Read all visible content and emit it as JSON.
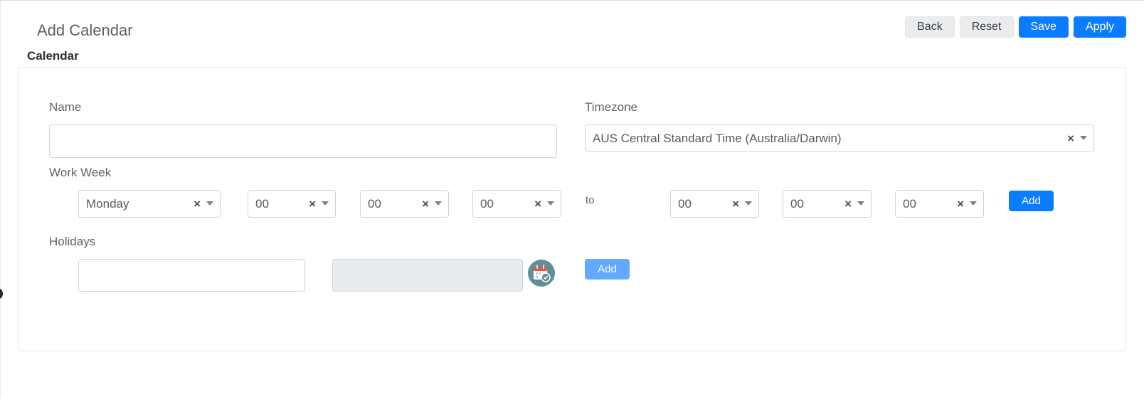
{
  "header": {
    "title": "Add Calendar",
    "section": "Calendar"
  },
  "toolbar": {
    "back_label": "Back",
    "reset_label": "Reset",
    "save_label": "Save",
    "apply_label": "Apply"
  },
  "form": {
    "name_label": "Name",
    "name_value": "",
    "timezone_label": "Timezone",
    "timezone_value": "AUS Central Standard Time (Australia/Darwin)",
    "work_week_label": "Work Week",
    "work_week": {
      "day": "Monday",
      "from_hour": "00",
      "from_minute": "00",
      "from_second": "00",
      "to_label": "to",
      "to_hour": "00",
      "to_minute": "00",
      "to_second": "00",
      "add_label": "Add"
    },
    "holidays_label": "Holidays",
    "holidays": {
      "name_value": "",
      "date_value": "",
      "add_label": "Add"
    }
  },
  "icons": {
    "clear": "×",
    "calendar_icon": "calendar-clock-icon",
    "caret": "chevron-down-icon"
  },
  "colors": {
    "primary": "#0b7bff",
    "primary_disabled": "#62a9ff",
    "light_button": "#ebecee",
    "calendar_icon_bg": "#5f8f9c"
  }
}
